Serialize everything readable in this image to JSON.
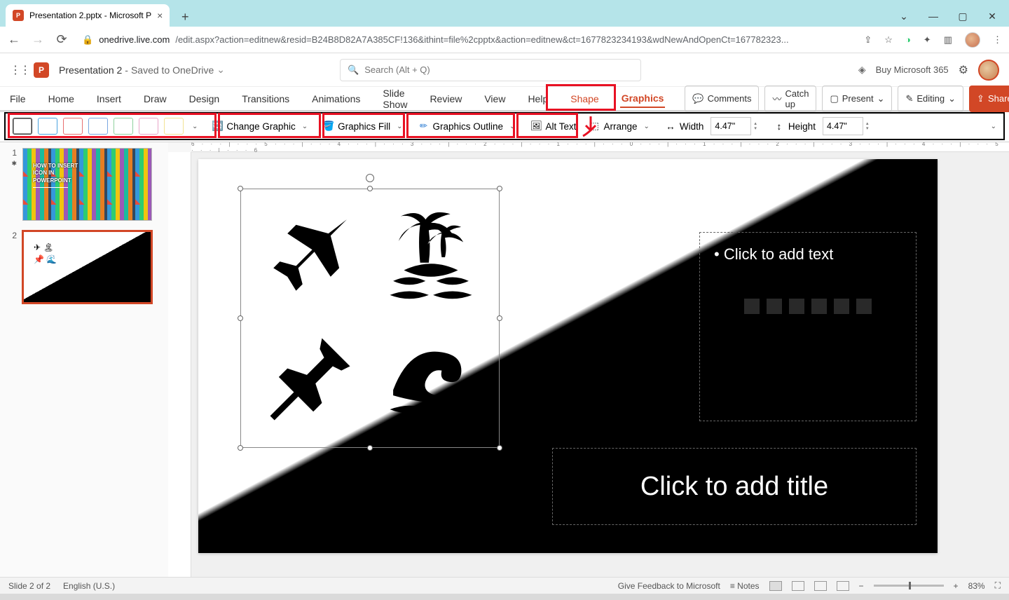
{
  "browser": {
    "tab_title": "Presentation 2.pptx - Microsoft P",
    "url_domain": "onedrive.live.com",
    "url_path": "/edit.aspx?action=editnew&resid=B24B8D82A7A385CF!136&ithint=file%2cpptx&action=editnew&ct=1677823234193&wdNewAndOpenCt=167782323..."
  },
  "header": {
    "doc_name": "Presentation 2",
    "save_state": "Saved to OneDrive",
    "search_placeholder": "Search (Alt + Q)",
    "buy": "Buy Microsoft 365"
  },
  "ribbon": {
    "tabs": {
      "file": "File",
      "home": "Home",
      "insert": "Insert",
      "draw": "Draw",
      "design": "Design",
      "transitions": "Transitions",
      "animations": "Animations",
      "slideshow": "Slide Show",
      "review": "Review",
      "view": "View",
      "help": "Help",
      "shape": "Shape",
      "graphics": "Graphics"
    },
    "right": {
      "comments": "Comments",
      "catchup": "Catch up",
      "present": "Present",
      "editing": "Editing",
      "share": "Share"
    }
  },
  "graphics_row": {
    "change": "Change Graphic",
    "fill": "Graphics Fill",
    "outline": "Graphics Outline",
    "alttext": "Alt Text",
    "arrange": "Arrange",
    "width": "Width",
    "width_val": "4.47\"",
    "height": "Height",
    "height_val": "4.47\""
  },
  "thumb1": {
    "l1": "HOW TO INSERT",
    "l2": "ICON IN",
    "l3": "POWERPOINT"
  },
  "canvas": {
    "icons": [
      "airplane-icon",
      "island-icon",
      "pin-icon",
      "wave-icon"
    ],
    "text_ph": "Click to add text",
    "title_ph": "Click to add title"
  },
  "status": {
    "slide": "Slide 2 of 2",
    "lang": "English (U.S.)",
    "feedback": "Give Feedback to Microsoft",
    "notes": "Notes",
    "zoom": "83%"
  },
  "ruler_ticks": "6 · · · | · · · 5 · · · | · · · 4 · · · | · · · 3 · · · | · · · 2 · · · | · · · 1 · · · | · · · 0 · · · | · · · 1 · · · | · · · 2 · · · | · · · 3 · · · | · · · 4 · · · | · · · 5 · · · | · · · 6"
}
